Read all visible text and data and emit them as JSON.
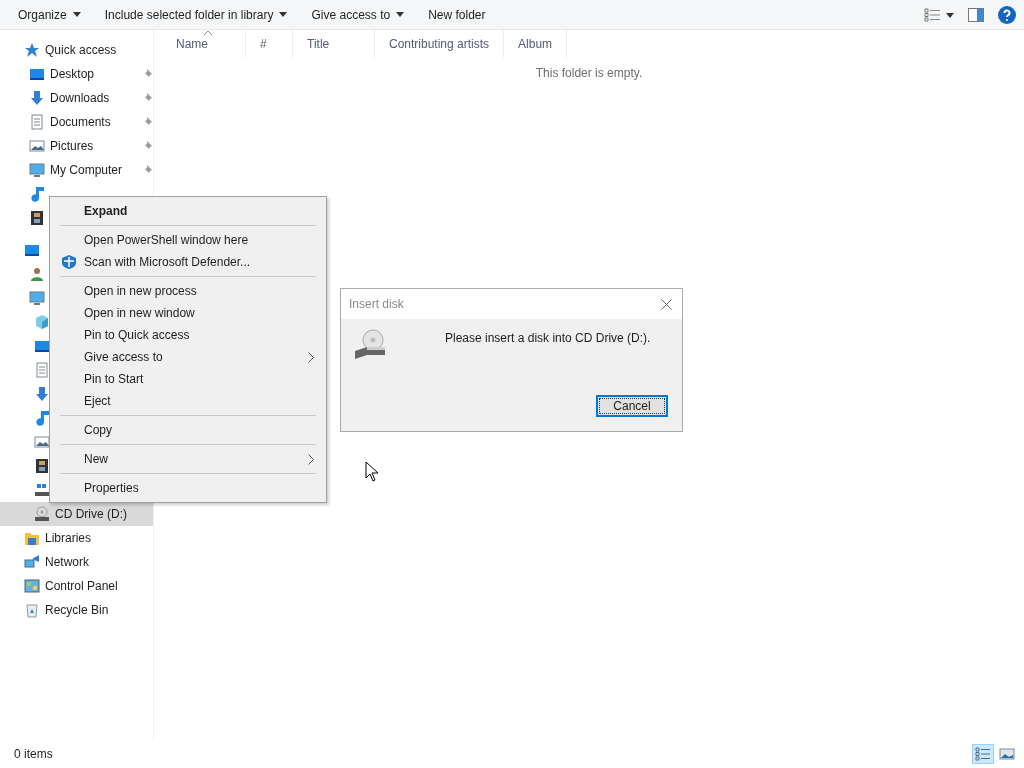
{
  "toolbar": {
    "buttons": [
      {
        "label": "Organize",
        "dropdown": true
      },
      {
        "label": "Include selected folder in library",
        "dropdown": true
      },
      {
        "label": "Give access to",
        "dropdown": true
      },
      {
        "label": "New folder",
        "dropdown": false
      }
    ]
  },
  "sidebar": {
    "items": [
      {
        "label": "Quick access",
        "kind": "star",
        "selected": false,
        "children": [
          {
            "label": "Desktop",
            "kind": "desktop",
            "pinned": true,
            "selected": false
          },
          {
            "label": "Downloads",
            "kind": "download",
            "pinned": true,
            "selected": false
          },
          {
            "label": "Documents",
            "kind": "document",
            "pinned": true,
            "selected": false
          },
          {
            "label": "Pictures",
            "kind": "picture",
            "pinned": true,
            "selected": false
          },
          {
            "label": "My Computer",
            "kind": "computer",
            "pinned": true,
            "selected": false
          },
          {
            "kind": "music",
            "selected": false
          },
          {
            "kind": "video",
            "selected": false
          }
        ]
      },
      {
        "kind": "desktop",
        "selected": false,
        "children": [
          {
            "kind": "user",
            "selected": false
          },
          {
            "kind": "computer",
            "selected": false,
            "children": [
              {
                "kind": "cube",
                "selected": false
              },
              {
                "kind": "desktop",
                "selected": false
              },
              {
                "kind": "document",
                "selected": false
              },
              {
                "kind": "download",
                "selected": false
              },
              {
                "kind": "music",
                "selected": false
              },
              {
                "kind": "picture",
                "selected": false
              },
              {
                "kind": "video",
                "selected": false
              },
              {
                "kind": "drive",
                "selected": false
              },
              {
                "label": "CD Drive (D:)",
                "kind": "cd",
                "selected": true
              }
            ]
          }
        ]
      },
      {
        "label": "Libraries",
        "kind": "library",
        "selected": false
      },
      {
        "label": "Network",
        "kind": "network",
        "selected": false
      },
      {
        "label": "Control Panel",
        "kind": "control",
        "selected": false
      },
      {
        "label": "Recycle Bin",
        "kind": "recycle",
        "selected": false
      }
    ]
  },
  "table": {
    "columns": [
      {
        "label": "Name",
        "sorted": true
      },
      {
        "label": "#",
        "sorted": false
      },
      {
        "label": "Title",
        "sorted": false
      },
      {
        "label": "Contributing artists",
        "sorted": false
      },
      {
        "label": "Album",
        "sorted": false
      }
    ],
    "empty_text": "This folder is empty."
  },
  "context_menu": {
    "items": [
      {
        "kind": "item",
        "label": "Expand",
        "default": true,
        "submenu": false
      },
      {
        "kind": "separator"
      },
      {
        "kind": "item",
        "label": "Open PowerShell window here",
        "default": false,
        "submenu": false
      },
      {
        "kind": "shield_item",
        "label": "Scan with Microsoft Defender...",
        "default": false,
        "submenu": false
      },
      {
        "kind": "separator"
      },
      {
        "kind": "item",
        "label": "Open in new process",
        "default": false,
        "submenu": false
      },
      {
        "kind": "item",
        "label": "Open in new window",
        "default": false,
        "submenu": false
      },
      {
        "kind": "item",
        "label": "Pin to Quick access",
        "default": false,
        "submenu": false
      },
      {
        "kind": "item",
        "label": "Give access to",
        "default": false,
        "submenu": true
      },
      {
        "kind": "item",
        "label": "Pin to Start",
        "default": false,
        "submenu": false
      },
      {
        "kind": "item",
        "label": "Eject",
        "default": false,
        "submenu": false
      },
      {
        "kind": "separator"
      },
      {
        "kind": "item",
        "label": "Copy",
        "default": false,
        "submenu": false
      },
      {
        "kind": "separator"
      },
      {
        "kind": "item",
        "label": "New",
        "default": false,
        "submenu": true
      },
      {
        "kind": "separator"
      },
      {
        "kind": "item",
        "label": "Properties",
        "default": false,
        "submenu": false
      }
    ]
  },
  "dialog": {
    "title": "Insert disk",
    "message": "Please insert a disk into CD Drive (D:).",
    "buttons": [
      {
        "label": "Cancel",
        "focused": true
      }
    ]
  },
  "status_bar": {
    "count": "0 items",
    "views": [
      {
        "kind": "details",
        "selected": true
      },
      {
        "kind": "large_icons",
        "selected": false
      }
    ]
  }
}
